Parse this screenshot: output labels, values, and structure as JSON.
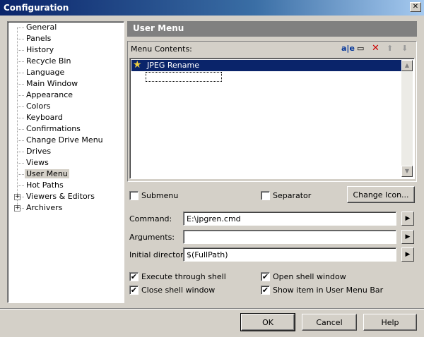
{
  "window": {
    "title": "Configuration"
  },
  "tree": {
    "items": [
      {
        "label": "General"
      },
      {
        "label": "Panels"
      },
      {
        "label": "History"
      },
      {
        "label": "Recycle Bin"
      },
      {
        "label": "Language"
      },
      {
        "label": "Main Window"
      },
      {
        "label": "Appearance"
      },
      {
        "label": "Colors"
      },
      {
        "label": "Keyboard"
      },
      {
        "label": "Confirmations"
      },
      {
        "label": "Change Drive Menu"
      },
      {
        "label": "Drives"
      },
      {
        "label": "Views"
      },
      {
        "label": "User Menu",
        "selected": true
      },
      {
        "label": "Hot Paths"
      },
      {
        "label": "Viewers & Editors",
        "expandable": true
      },
      {
        "label": "Archivers",
        "expandable": true
      }
    ]
  },
  "panel": {
    "title": "User Menu",
    "menu_contents_label": "Menu Contents:",
    "toolbar": {
      "rename_glyph": "a|e",
      "new_glyph": "▭",
      "delete_glyph": "✕",
      "up_glyph": "⬆",
      "down_glyph": "⬇"
    },
    "items": [
      {
        "label": "JPEG Rename",
        "icon": "star-icon"
      }
    ],
    "submenu_label": "Submenu",
    "separator_label": "Separator",
    "change_icon_label": "Change Icon...",
    "command_label": "Command:",
    "command_value": "E:\\jpgren.cmd",
    "arguments_label": "Arguments:",
    "arguments_value": "",
    "initial_dir_label": "Initial directory:",
    "initial_dir_value": "$(FullPath)",
    "options": {
      "execute_shell": {
        "label": "Execute through shell",
        "checked": true
      },
      "open_shell": {
        "label": "Open shell window",
        "checked": true
      },
      "close_shell": {
        "label": "Close shell window",
        "checked": true
      },
      "show_item": {
        "label": "Show item in User Menu Bar",
        "checked": true
      }
    }
  },
  "buttons": {
    "ok": "OK",
    "cancel": "Cancel",
    "help": "Help"
  },
  "colors": {
    "selection": "#0a246a",
    "face": "#d4d0c8",
    "delete": "#cc0000"
  }
}
